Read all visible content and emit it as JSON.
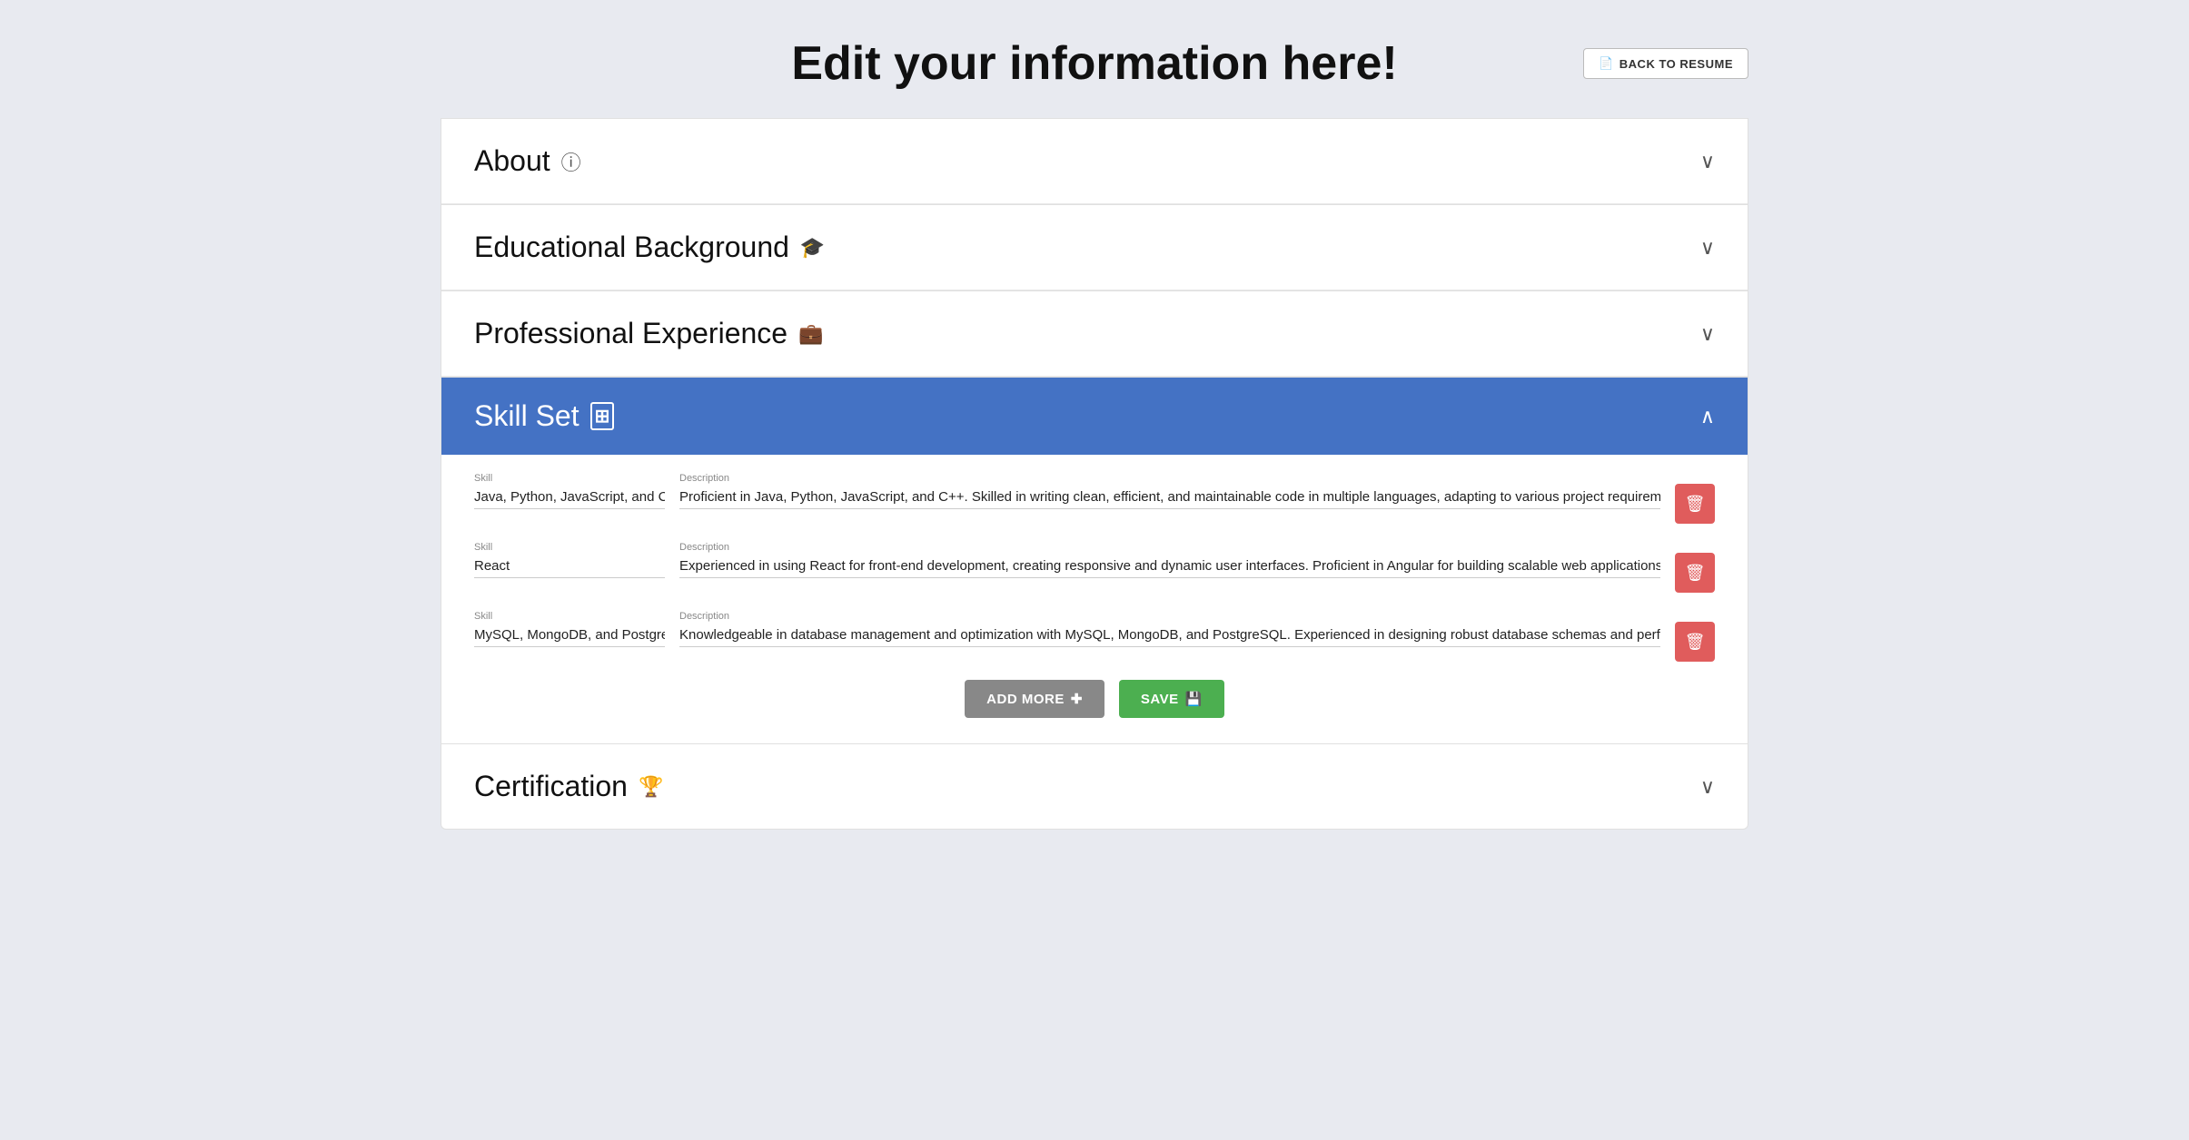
{
  "header": {
    "title": "Edit your information here!",
    "back_button_label": "BACK TO RESUME",
    "back_button_icon": "📄"
  },
  "sections": {
    "about": {
      "label": "About",
      "icon": "ℹ",
      "chevron": "∨"
    },
    "educational_background": {
      "label": "Educational Background",
      "icon": "🎓",
      "chevron": "∨"
    },
    "professional_experience": {
      "label": "Professional Experience",
      "icon": "💼",
      "chevron": "∨"
    },
    "skill_set": {
      "label": "Skill Set",
      "icon": "⊞",
      "chevron": "∧",
      "skills": [
        {
          "skill_label": "Skill",
          "skill_value": "Java, Python, JavaScript, and C++",
          "desc_label": "Description",
          "desc_value": "Proficient in Java, Python, JavaScript, and C++. Skilled in writing clean, efficient, and maintainable code in multiple languages, adapting to various project requirements."
        },
        {
          "skill_label": "Skill",
          "skill_value": "React",
          "desc_label": "Description",
          "desc_value": "Experienced in using React for front-end development, creating responsive and dynamic user interfaces. Proficient in Angular for building scalable web applications. Skilled in l"
        },
        {
          "skill_label": "Skill",
          "skill_value": "MySQL, MongoDB, and PostgreS",
          "desc_label": "Description",
          "desc_value": "Knowledgeable in database management and optimization with MySQL, MongoDB, and PostgreSQL. Experienced in designing robust database schemas and performing compl"
        }
      ],
      "add_more_label": "ADD MORE",
      "save_label": "SAVE"
    },
    "certification": {
      "label": "Certification",
      "icon": "🏆",
      "chevron": "∨"
    }
  }
}
